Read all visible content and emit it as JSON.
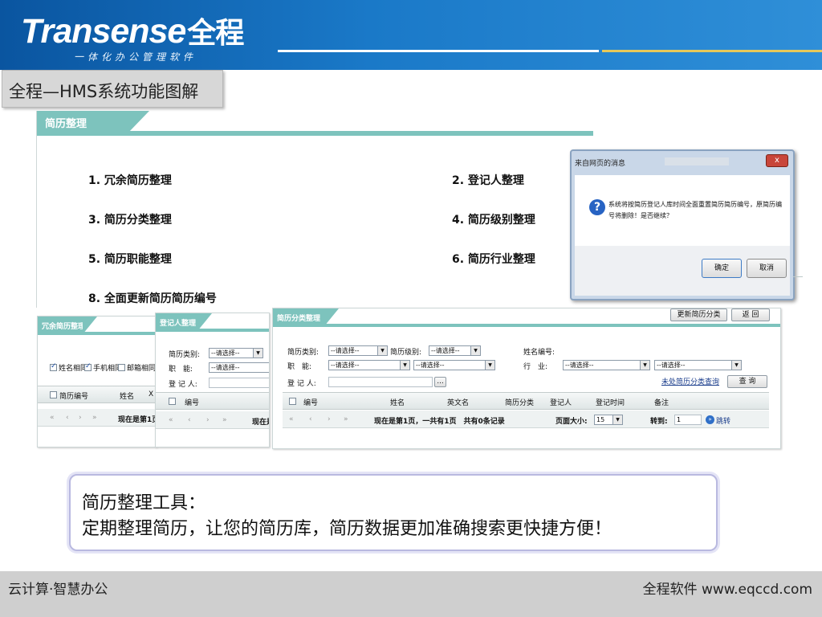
{
  "header": {
    "logo_text": "Transense",
    "logo_cn": "全程",
    "slogan": "一体化办公管理软件"
  },
  "title": "全程—HMS系统功能图解",
  "main_panel": {
    "tab": "简历整理",
    "items": [
      "1. 冗余简历整理",
      "2. 登记人整理",
      "3. 简历分类整理",
      "4. 简历级别整理",
      "5. 简历职能整理",
      "6. 简历行业整理",
      "8. 全面更新简历简历编号"
    ]
  },
  "dialog": {
    "title": "来自网页的消息",
    "close": "x",
    "icon": "?",
    "message": "系统将按简历登记人库时间全面重置简历简历编号，原简历编号将删除！是否继续？",
    "ok": "确定",
    "cancel": "取消"
  },
  "redundant_panel": {
    "tab": "冗余简历整理",
    "checks": [
      "姓名相同",
      "手机相同",
      "邮箱相同"
    ],
    "col_id": "简历编号",
    "col_name": "姓名",
    "col_extra": "X",
    "pager_status": "现在是第1页"
  },
  "register_panel": {
    "tab": "登记人整理",
    "label_type": "简历类别:",
    "label_func": "职　能:",
    "label_reg": "登 记 人:",
    "select_type": "--请选择--",
    "select_func": "--请选择--",
    "col_id": "编号",
    "pager_status": "现在是"
  },
  "category_panel": {
    "tab": "简历分类整理",
    "update_btn": "更新简历分类",
    "back_btn": "返 回",
    "label_type": "简历类别:",
    "label_level": "简历级别:",
    "label_func": "职　能:",
    "label_reg": "登 记 人:",
    "label_resume_no": "姓名编号:",
    "label_industry": "行　业:",
    "select_placeholder": "--请选择--",
    "browse_btn": "...",
    "link_unclassified": "未处简历分类查询",
    "query_btn": "查 询",
    "columns": [
      "编号",
      "姓名",
      "英文名",
      "简历分类",
      "登记人",
      "登记时间",
      "备注"
    ],
    "pager_status": "现在是第1页，一共有1页　共有0条记录",
    "page_size_label": "页面大小:",
    "page_size": "15",
    "goto_label": "转到:",
    "goto_value": "1",
    "jump": "跳转"
  },
  "callout": {
    "line1": "简历整理工具：",
    "line2": "定期整理简历，让您的简历库，简历数据更加准确搜索更快捷方便！"
  },
  "footer": {
    "left": "云计算·智慧办公",
    "right": "全程软件 www.eqccd.com"
  }
}
